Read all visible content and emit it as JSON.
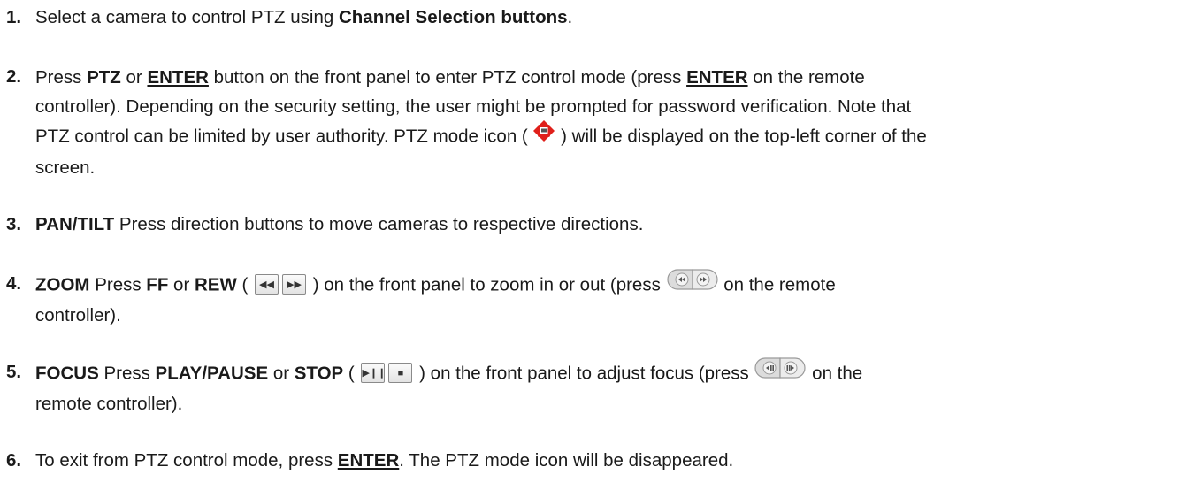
{
  "steps": [
    {
      "num": "1.",
      "parts": {
        "a": "Select a camera to control PTZ using ",
        "b": "Channel Selection buttons",
        "c": "."
      }
    },
    {
      "num": "2.",
      "parts": {
        "a": "Press ",
        "b": "PTZ",
        "c": " or ",
        "d": "ENTER",
        "e": " button on the front panel to enter PTZ control mode (press ",
        "f": "ENTER",
        "g": " on the remote",
        "h": "controller). Depending on the security setting, the user might be prompted for password verification. Note that",
        "i": "PTZ control can be limited by user authority. PTZ mode icon ( ",
        "j": " ) will be displayed on the top-left corner of the",
        "k": "screen."
      }
    },
    {
      "num": "3.",
      "parts": {
        "a": "PAN/TILT",
        "b": " Press direction buttons to move cameras to respective directions."
      }
    },
    {
      "num": "4.",
      "parts": {
        "a": "ZOOM",
        "b": " Press ",
        "c": "FF",
        "d": " or ",
        "e": "REW",
        "f": " ( ",
        "g": " ) on the front panel to zoom in or out (press ",
        "h": " on the remote",
        "i": "controller)."
      }
    },
    {
      "num": "5.",
      "parts": {
        "a": "FOCUS",
        "b": " Press ",
        "c": "PLAY/PAUSE",
        "d": " or ",
        "e": "STOP",
        "f": " ( ",
        "g": " ) on the front panel to adjust focus (press ",
        "h": " on the",
        "i": "remote controller)."
      }
    },
    {
      "num": "6.",
      "parts": {
        "a": "To exit from PTZ control mode, press ",
        "b": "ENTER",
        "c": ". The PTZ mode icon will be disappeared."
      }
    }
  ],
  "icons": {
    "ptz_mode": "ptz-mode-icon",
    "rew_button": "rewind-button-icon",
    "ff_button": "fast-forward-button-icon",
    "play_pause_button": "play-pause-button-icon",
    "stop_button": "stop-button-icon",
    "remote_zoom": "remote-zoom-buttons-icon",
    "remote_focus": "remote-focus-buttons-icon"
  },
  "colors": {
    "text": "#1a1a1a",
    "ptz_icon_red": "#e0201b"
  }
}
